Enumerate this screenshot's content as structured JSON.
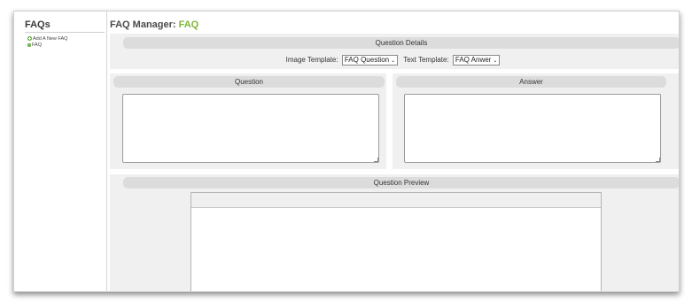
{
  "sidebar": {
    "title": "FAQs",
    "items": [
      {
        "label": "Add A New FAQ",
        "icon": "add-icon"
      },
      {
        "label": "FAQ",
        "icon": "faq-doc-icon"
      }
    ]
  },
  "main": {
    "title": "FAQ Manager:",
    "title_accent": "FAQ",
    "accent_color": "#7fb539"
  },
  "details": {
    "header": "Question Details",
    "image_template_label": "Image Template:",
    "image_template_value": "FAQ Question",
    "text_template_label": "Text Template:",
    "text_template_value": "FAQ Anwer"
  },
  "question": {
    "header": "Question",
    "value": ""
  },
  "answer": {
    "header": "Answer",
    "value": ""
  },
  "preview": {
    "header": "Question Preview"
  }
}
